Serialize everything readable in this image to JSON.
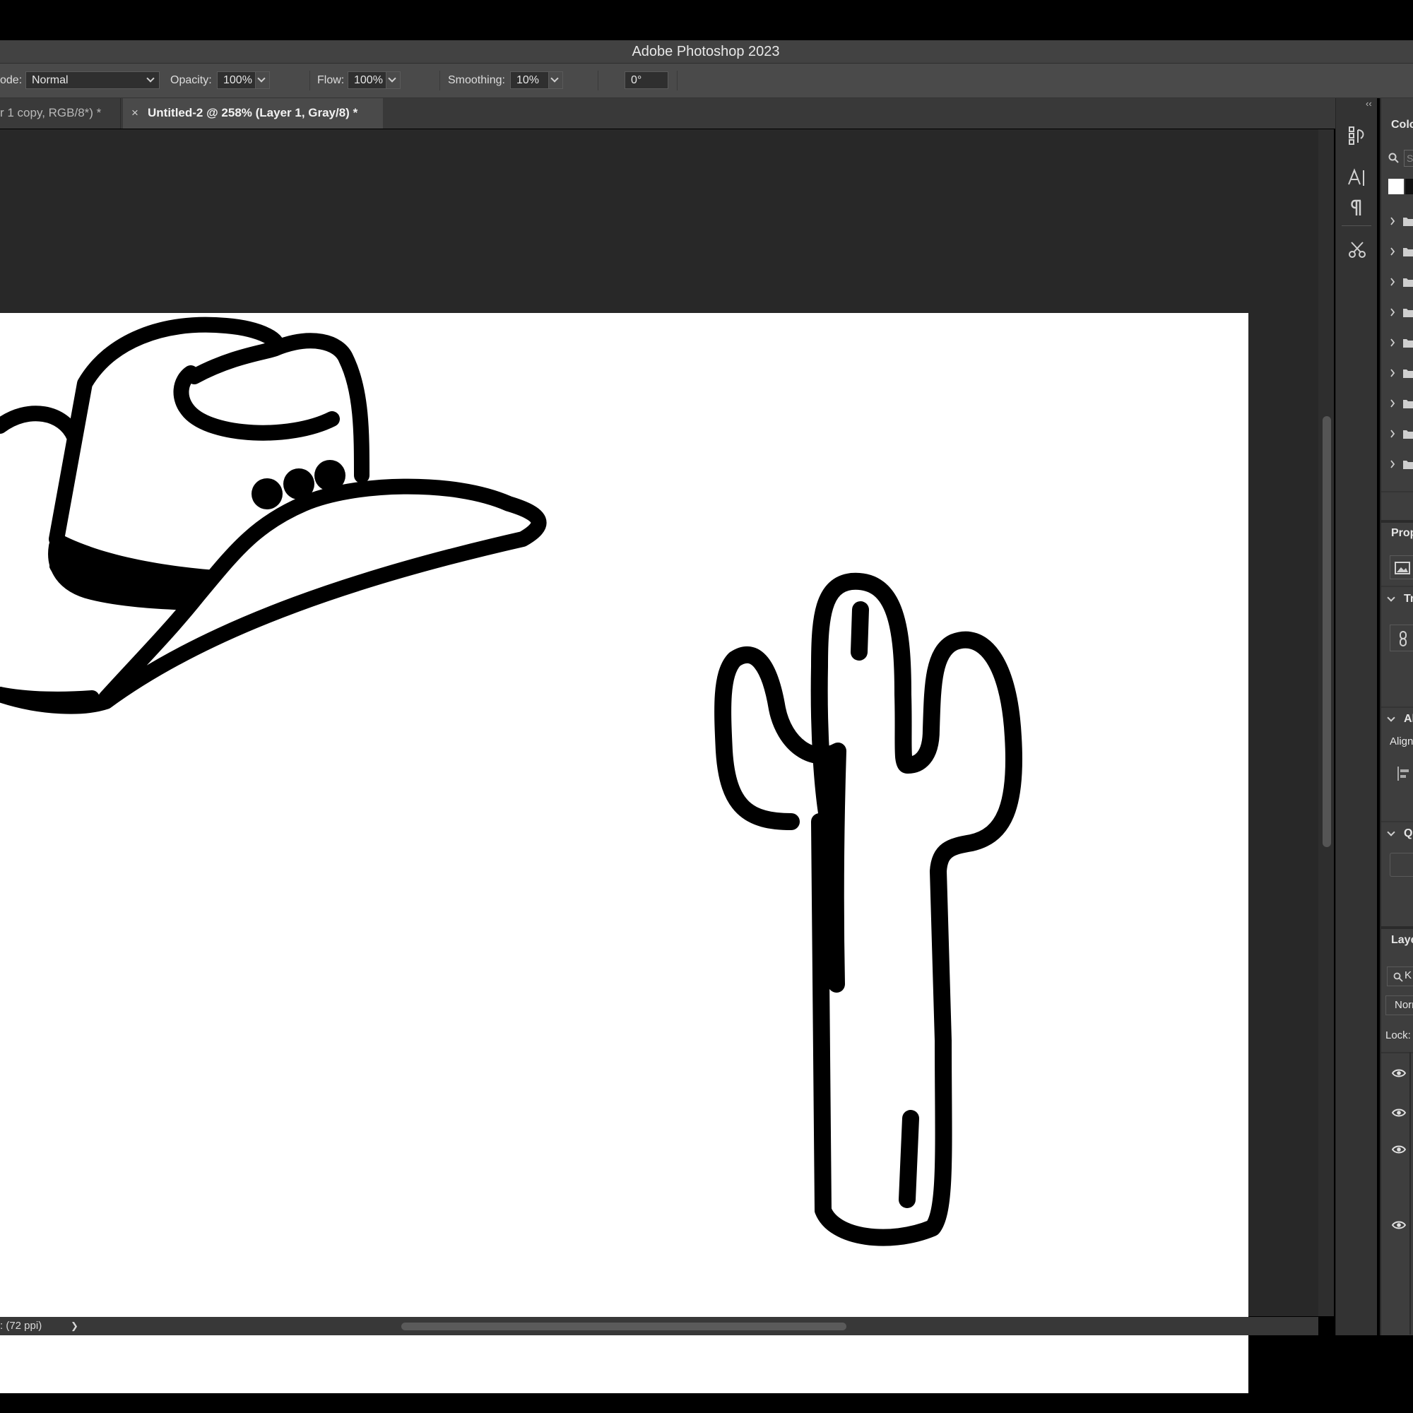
{
  "app": {
    "title": "Adobe Photoshop 2023"
  },
  "options_bar": {
    "mode_label": "ode:",
    "mode_value": "Normal",
    "opacity_label": "Opacity:",
    "opacity_value": "100%",
    "flow_label": "Flow:",
    "flow_value": "100%",
    "smoothing_label": "Smoothing:",
    "smoothing_value": "10%",
    "angle_value": "0°"
  },
  "tabs": [
    {
      "label": "r 1 copy, RGB/8*) *",
      "active": false
    },
    {
      "close": "×",
      "label": "Untitled-2 @ 258% (Layer 1, Gray/8) *",
      "active": true
    }
  ],
  "status_bar": {
    "text": ": (72 ppi)",
    "arrow": "❯"
  },
  "panel": {
    "collapse_glyph": "‹‹",
    "color_header": "Colo",
    "swatches_search_placeholder": "S",
    "properties_header": "Prop",
    "transform_header": "Tr",
    "align_header": "Al",
    "align_label": "Align",
    "quick_actions_header": "Qu",
    "layers_header": "Laye",
    "layers_search": "K",
    "blend_mode": "Norr",
    "lock_label": "Lock:"
  },
  "colors": {
    "accent_active_tab": "#4a4a4a",
    "canvas": "#ffffff",
    "ink": "#000000",
    "workspace": "#282828"
  }
}
